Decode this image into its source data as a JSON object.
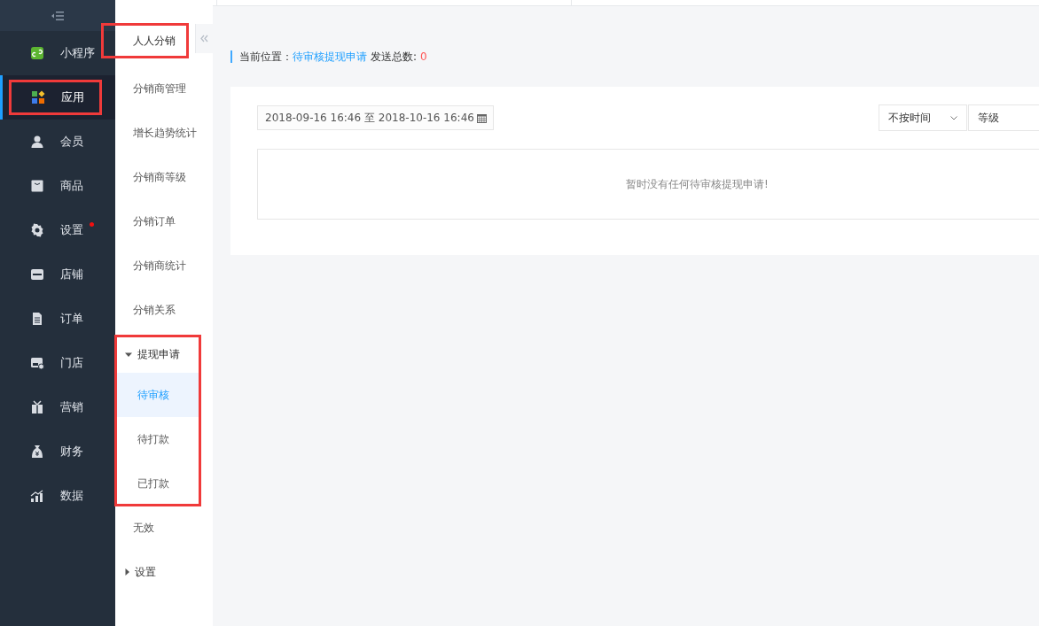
{
  "nav": [
    {
      "label": "小程序",
      "selected": false,
      "highlighted": false,
      "badge": false
    },
    {
      "label": "应用",
      "selected": true,
      "highlighted": true,
      "badge": false
    },
    {
      "label": "会员",
      "selected": false,
      "highlighted": false,
      "badge": false
    },
    {
      "label": "商品",
      "selected": false,
      "highlighted": false,
      "badge": false
    },
    {
      "label": "设置",
      "selected": false,
      "highlighted": false,
      "badge": true
    },
    {
      "label": "店铺",
      "selected": false,
      "highlighted": false,
      "badge": false
    },
    {
      "label": "订单",
      "selected": false,
      "highlighted": false,
      "badge": false
    },
    {
      "label": "门店",
      "selected": false,
      "highlighted": false,
      "badge": false
    },
    {
      "label": "营销",
      "selected": false,
      "highlighted": false,
      "badge": false
    },
    {
      "label": "财务",
      "selected": false,
      "highlighted": false,
      "badge": false
    },
    {
      "label": "数据",
      "selected": false,
      "highlighted": false,
      "badge": false
    }
  ],
  "submenu": {
    "title": "人人分销",
    "highlighted": true,
    "items": [
      {
        "kind": "link",
        "label": "分销商管理",
        "selected": false
      },
      {
        "kind": "link",
        "label": "增长趋势统计",
        "selected": false
      },
      {
        "kind": "link",
        "label": "分销商等级",
        "selected": false
      },
      {
        "kind": "link",
        "label": "分销订单",
        "selected": false
      },
      {
        "kind": "link",
        "label": "分销商统计",
        "selected": false
      },
      {
        "kind": "link",
        "label": "分销关系",
        "selected": false
      },
      {
        "kind": "group",
        "label": "提现申请",
        "expanded": true,
        "highlighted": true,
        "children": [
          {
            "label": "待审核",
            "selected": true
          },
          {
            "label": "待打款",
            "selected": false
          },
          {
            "label": "已打款",
            "selected": false
          }
        ]
      },
      {
        "kind": "link",
        "label": "无效",
        "selected": false
      },
      {
        "kind": "group",
        "label": "设置",
        "expanded": false,
        "highlighted": false
      }
    ]
  },
  "breadcrumb": {
    "label": "当前位置：",
    "current": "待审核提现申请",
    "count_label": "发送总数:",
    "count": "0"
  },
  "filters": {
    "date_range": "2018-09-16 16:46 至 2018-10-16 16:46",
    "time_select": "不按时间",
    "level_select": "等级"
  },
  "empty_message": "暂时没有任何待审核提现申请!"
}
